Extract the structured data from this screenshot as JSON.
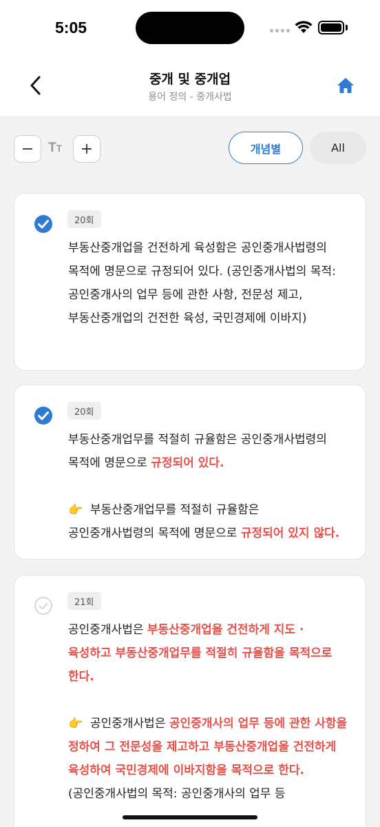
{
  "status_bar": {
    "time": "5:05"
  },
  "nav": {
    "title": "중개 및 중개업",
    "subtitle": "용어 정의 - 중개사법",
    "back_icon": "chevron-left-icon",
    "home_icon": "home-icon"
  },
  "toolbar": {
    "decrease_label": "−",
    "increase_label": "+",
    "font_icon_big": "T",
    "font_icon_small": "T",
    "concept_label": "개념별",
    "all_label": "All"
  },
  "colors": {
    "accent": "#2f7bd3",
    "highlight": "#e8504a"
  },
  "cards": [
    {
      "checked": true,
      "round": "20회",
      "text": "부동산중개업을 건전하게 육성함은 공인중개사법령의 목적에 명문으로 규정되어 있다. (공인중개사법의 목적: 공인중개사의 업무 등에 관한 사항, 전문성 제고, 부동산중개업의 건전한 육성, 국민경제에 이바지)"
    },
    {
      "checked": true,
      "round": "20회",
      "text_pre": "부동산중개업무를 적절히 규율함은 공인중개사법령의 목적에 명문으로 ",
      "text_hl": "규정되어 있다.",
      "note_icon": "👉",
      "note_pre": "부동산중개업무를 적절히 규율함은 공인중개사법령의 목적에 명문으로 ",
      "note_hl": "규정되어 있지 않다."
    },
    {
      "checked": false,
      "round": "21회",
      "text_pre": "공인중개사법은 ",
      "text_hl": "부동산중개업을 건전하게 지도 · 육성하고 부동산중개업무를 적절히 규율함을 목적으로 한다.",
      "note_icon": "👉",
      "note_pre": "공인중개사법은 ",
      "note_hl": "공인중개사의 업무 등에 관한 사항을 정하여 그 전문성을 제고하고 부동산중개업을 건전하게 육성하여 국민경제에 이바지함을 목적으로 한다.",
      "note_post": " (공인중개사법의 목적: 공인중개사의 업무 등"
    }
  ]
}
